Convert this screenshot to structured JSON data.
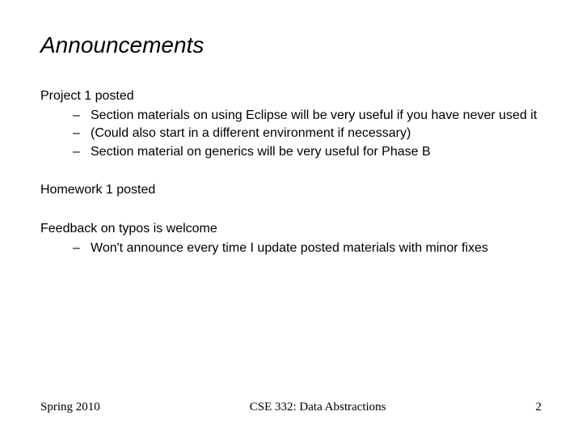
{
  "title": "Announcements",
  "sections": [
    {
      "head": "Project 1 posted",
      "items": [
        "Section materials on using Eclipse will be very useful if you have never used it",
        "(Could also start in a different environment if necessary)",
        "Section material on generics will be very useful for Phase B"
      ]
    },
    {
      "head": "Homework 1 posted",
      "items": []
    },
    {
      "head": "Feedback on typos is welcome",
      "items": [
        "Won't announce every time I update posted materials with minor fixes"
      ]
    }
  ],
  "footer": {
    "left": "Spring 2010",
    "center": "CSE 332: Data Abstractions",
    "right": "2"
  },
  "dash": "–"
}
